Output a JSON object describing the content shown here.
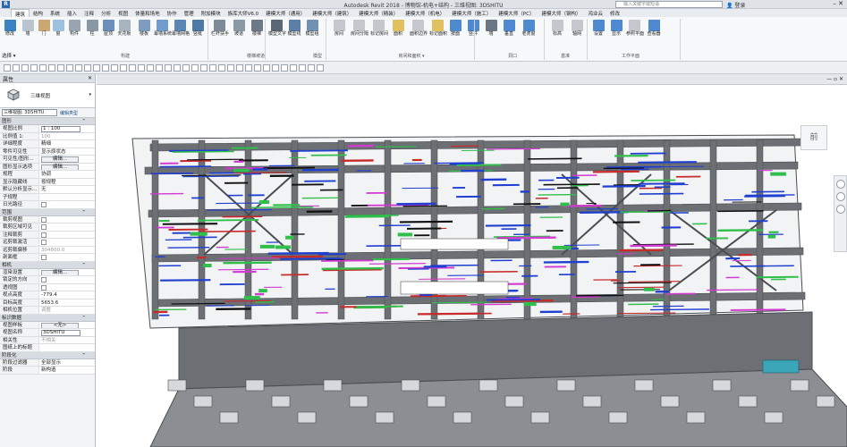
{
  "window": {
    "title": "Autodesk Revit 2018 -    博物馆-机电+结构 - 三维视图: 3DSHITU",
    "search_placeholder": "输入关键字或短语",
    "login_label": "登录",
    "app_logo": "R"
  },
  "tabs": [
    "建筑",
    "结构",
    "系统",
    "插入",
    "注释",
    "分析",
    "视图",
    "体量和场地",
    "协作",
    "管理",
    "附加模块",
    "族库大师V6.0",
    "建模大师（通用）",
    "建模大师（建筑）",
    "建模大师（精装）",
    "建模大师（机电）",
    "建模大师（施工）",
    "建模大师（PC）",
    "建模大师（钢构）",
    "鸿业云",
    "修改"
  ],
  "ribbon": {
    "buttons": [
      {
        "label": "修改",
        "color": "#3b82c4"
      },
      {
        "label": "墙",
        "color": "#b8c4d0"
      },
      {
        "label": "门",
        "color": "#c9a874"
      },
      {
        "label": "窗",
        "color": "#9ec1e0"
      },
      {
        "label": "构件",
        "color": "#9aa5b1"
      },
      {
        "label": "柱",
        "color": "#8a97a5"
      },
      {
        "label": "屋顶",
        "color": "#6a8fb8"
      },
      {
        "label": "天花板",
        "color": "#a8b4c0"
      },
      {
        "label": "楼板",
        "color": "#7e9cbf"
      },
      {
        "label": "幕墙系统",
        "color": "#6f9ccd"
      },
      {
        "label": "幕墙网格",
        "color": "#5c86b3"
      },
      {
        "label": "竖梃",
        "color": "#4f79a6"
      },
      {
        "label": "栏杆扶手",
        "color": "#7d8b99"
      },
      {
        "label": "坡道",
        "color": "#8b99a7"
      },
      {
        "label": "楼梯",
        "color": "#6c7a88"
      },
      {
        "label": "模型文字",
        "color": "#5b6773"
      },
      {
        "label": "模型线",
        "color": "#5b7fa6"
      },
      {
        "label": "模型组",
        "color": "#7291b2"
      },
      {
        "label": "房间",
        "color": "#c4c8cc"
      },
      {
        "label": "房间分隔",
        "color": "#c4c8cc"
      },
      {
        "label": "标记房间",
        "color": "#c4c8cc"
      },
      {
        "label": "面积",
        "color": "#e0c060"
      },
      {
        "label": "面积边界",
        "color": "#c4c8cc"
      },
      {
        "label": "标记面积",
        "color": "#e0c060"
      },
      {
        "label": "按面",
        "color": "#4f8ad0"
      },
      {
        "label": "竖井",
        "color": "#4f8ad0"
      },
      {
        "label": "墙",
        "color": "#6b7785"
      },
      {
        "label": "垂直",
        "color": "#4f8ad0"
      },
      {
        "label": "老虎窗",
        "color": "#4f8ad0"
      },
      {
        "label": "标高",
        "color": "#c4c8cc"
      },
      {
        "label": "轴网",
        "color": "#c4c8cc"
      },
      {
        "label": "设置",
        "color": "#4f8ad0"
      },
      {
        "label": "显示",
        "color": "#4f8ad0"
      },
      {
        "label": "参照平面",
        "color": "#c4c8cc"
      },
      {
        "label": "查看器",
        "color": "#4f8ad0"
      }
    ],
    "groups": [
      "构建",
      "楼梯坡道",
      "模型",
      "房间和面积 ▾",
      "洞口",
      "基准",
      "工作平面"
    ]
  },
  "select_label": "选择 ▾",
  "properties": {
    "header": "属性",
    "type_name": "三维视图",
    "instance_selector": "三维视图: 3DSHITU",
    "edit_type": "编辑类型",
    "sections": [
      {
        "name": "图形",
        "rows": [
          {
            "k": "视图比例",
            "v": "1 : 100",
            "kind": "box"
          },
          {
            "k": "比例值 1:",
            "v": "100",
            "kind": "gray"
          },
          {
            "k": "详细程度",
            "v": "精细",
            "kind": "text"
          },
          {
            "k": "零件可见性",
            "v": "显示原状态",
            "kind": "text"
          },
          {
            "k": "可见性/图形...",
            "v": "编辑...",
            "kind": "button"
          },
          {
            "k": "图形显示选项",
            "v": "编辑...",
            "kind": "button"
          },
          {
            "k": "规程",
            "v": "协调",
            "kind": "text"
          },
          {
            "k": "显示隐藏线",
            "v": "按规程",
            "kind": "text"
          },
          {
            "k": "默认分析显示...",
            "v": "无",
            "kind": "text"
          },
          {
            "k": "子规程",
            "v": "",
            "kind": "text"
          },
          {
            "k": "日光路径",
            "v": "",
            "kind": "check"
          }
        ]
      },
      {
        "name": "范围",
        "rows": [
          {
            "k": "裁剪视图",
            "v": "",
            "kind": "check"
          },
          {
            "k": "裁剪区域可见",
            "v": "",
            "kind": "check"
          },
          {
            "k": "注释裁剪",
            "v": "",
            "kind": "check"
          },
          {
            "k": "远剪裁激活",
            "v": "",
            "kind": "check"
          },
          {
            "k": "远剪裁偏移",
            "v": "304800.0",
            "kind": "gray"
          },
          {
            "k": "剖面框",
            "v": "",
            "kind": "check"
          }
        ]
      },
      {
        "name": "相机",
        "rows": [
          {
            "k": "渲染设置",
            "v": "编辑...",
            "kind": "button"
          },
          {
            "k": "锁定的方向",
            "v": "",
            "kind": "check"
          },
          {
            "k": "透视图",
            "v": "",
            "kind": "check"
          },
          {
            "k": "视点高度",
            "v": "-779.4",
            "kind": "text"
          },
          {
            "k": "目标高度",
            "v": "5653.6",
            "kind": "text"
          },
          {
            "k": "相机位置",
            "v": "调整",
            "kind": "gray"
          }
        ]
      },
      {
        "name": "标识数据",
        "rows": [
          {
            "k": "视图样板",
            "v": "<无>",
            "kind": "button"
          },
          {
            "k": "视图名称",
            "v": "3DSHITU",
            "kind": "box"
          },
          {
            "k": "相关性",
            "v": "不相关",
            "kind": "gray"
          },
          {
            "k": "图纸上的标题",
            "v": "",
            "kind": "text"
          }
        ]
      },
      {
        "name": "阶段化",
        "rows": [
          {
            "k": "阶段过滤器",
            "v": "全部显示",
            "kind": "text"
          },
          {
            "k": "阶段",
            "v": "新构造",
            "kind": "text"
          }
        ]
      }
    ]
  },
  "viewcube_label": "前",
  "colors": {
    "structure": "#6c6f73",
    "structure_dark": "#4a4d51",
    "pipe_blue": "#1f3fd1",
    "pipe_green": "#2fbf4a",
    "pipe_red": "#c82a2a",
    "pipe_magenta": "#d23ad2",
    "accent": "#2b66b1"
  }
}
